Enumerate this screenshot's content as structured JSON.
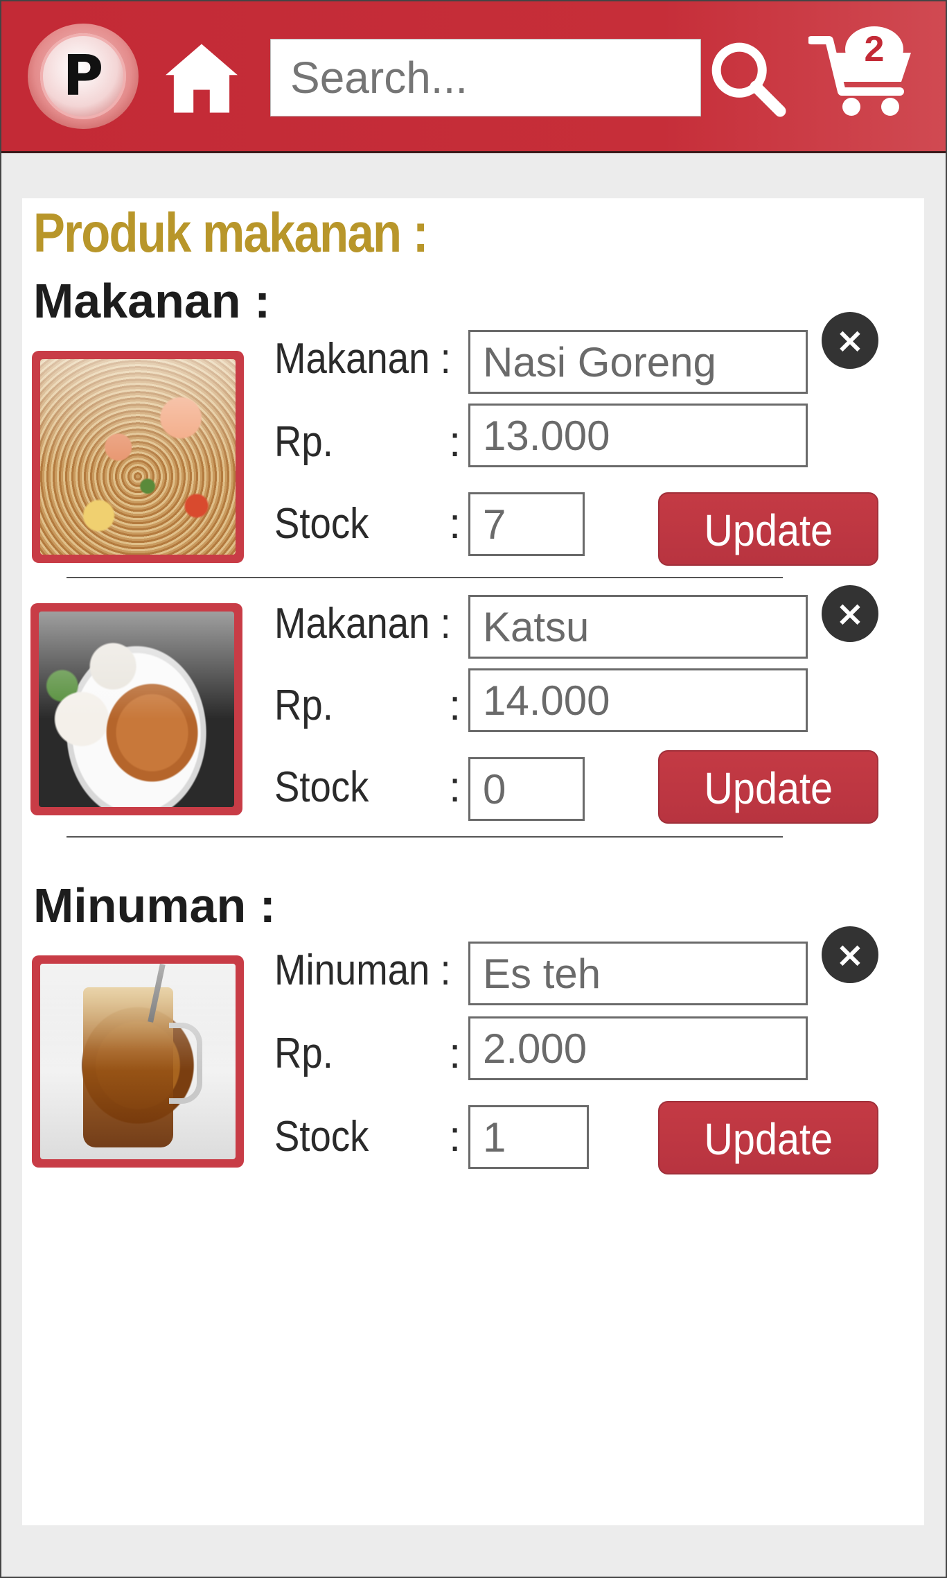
{
  "header": {
    "logo_letter": "P",
    "search_placeholder": "Search...",
    "cart_count": "2"
  },
  "page_title": "Produk makanan :",
  "sections": {
    "makanan": {
      "heading": "Makanan :",
      "items": [
        {
          "name_label": "Makanan :",
          "name": "Nasi Goreng",
          "price_label": "Rp.",
          "price": "13.000",
          "stock_label": "Stock",
          "stock": "7",
          "update_label": "Update",
          "image": "fried-rice-photo"
        },
        {
          "name_label": "Makanan :",
          "name": "Katsu",
          "price_label": "Rp.",
          "price": "14.000",
          "stock_label": "Stock",
          "stock": "0",
          "update_label": "Update",
          "image": "chicken-katsu-photo"
        }
      ]
    },
    "minuman": {
      "heading": "Minuman :",
      "items": [
        {
          "name_label": "Minuman :",
          "name": "Es teh",
          "price_label": "Rp.",
          "price": "2.000",
          "stock_label": "Stock",
          "stock": "1",
          "update_label": "Update",
          "image": "iced-tea-photo"
        }
      ]
    }
  },
  "delete_glyph": "×",
  "colon": ":",
  "colors": {
    "brand_red": "#c32a36",
    "title_gold": "#b8962a",
    "button_red": "#c43a44"
  }
}
